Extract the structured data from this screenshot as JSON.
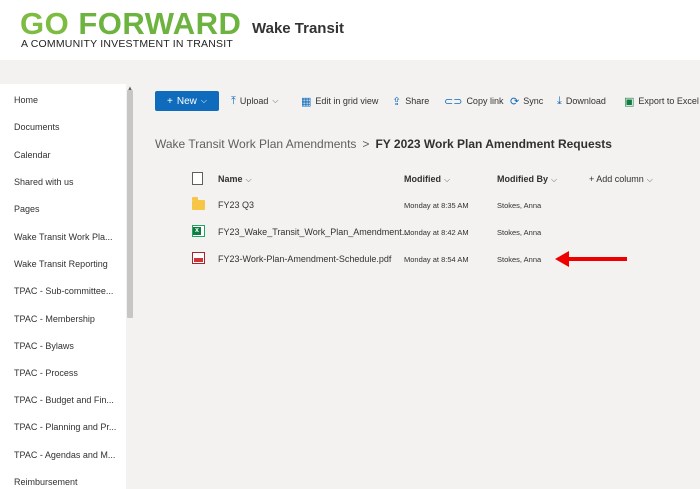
{
  "logo": {
    "main_go": "GO",
    "main_forward": "FORWARD",
    "tagline": "A COMMUNITY INVESTMENT IN TRANSIT"
  },
  "site": {
    "title": "Wake Transit"
  },
  "sidebar": {
    "items": [
      {
        "label": "Home"
      },
      {
        "label": "Documents"
      },
      {
        "label": "Calendar"
      },
      {
        "label": "Shared with us"
      },
      {
        "label": "Pages"
      },
      {
        "label": "Wake Transit Work Pla..."
      },
      {
        "label": "Wake Transit Reporting"
      },
      {
        "label": "TPAC - Sub-committee..."
      },
      {
        "label": "TPAC - Membership"
      },
      {
        "label": "TPAC - Bylaws"
      },
      {
        "label": "TPAC - Process"
      },
      {
        "label": "TPAC - Budget and Fin..."
      },
      {
        "label": "TPAC - Planning and Pr..."
      },
      {
        "label": "TPAC - Agendas and M..."
      },
      {
        "label": "Reimbursement"
      }
    ]
  },
  "commandbar": {
    "new": "New",
    "upload": "Upload",
    "edit_grid": "Edit in grid view",
    "share": "Share",
    "copy_link": "Copy link",
    "sync": "Sync",
    "download": "Download",
    "export_excel": "Export to Excel"
  },
  "breadcrumb": {
    "parent": "Wake Transit Work Plan Amendments",
    "separator": ">",
    "current": "FY 2023 Work Plan Amendment Requests"
  },
  "columns": {
    "name": "Name",
    "modified": "Modified",
    "modified_by": "Modified By",
    "add_column": "+ Add column"
  },
  "files": [
    {
      "type": "folder",
      "name": "FY23 Q3",
      "modified": "Monday at 8:35 AM",
      "modified_by": "Stokes, Anna"
    },
    {
      "type": "excel",
      "name": "FY23_Wake_Transit_Work_Plan_Amendment...",
      "modified": "Monday at 8:42 AM",
      "modified_by": "Stokes, Anna"
    },
    {
      "type": "pdf",
      "name": "FY23-Work-Plan-Amendment-Schedule.pdf",
      "modified": "Monday at 8:54 AM",
      "modified_by": "Stokes, Anna"
    }
  ],
  "colors": {
    "accent": "#0f6cbd",
    "logo_green": "#6db33f",
    "annotation_arrow": "#ee0000"
  }
}
